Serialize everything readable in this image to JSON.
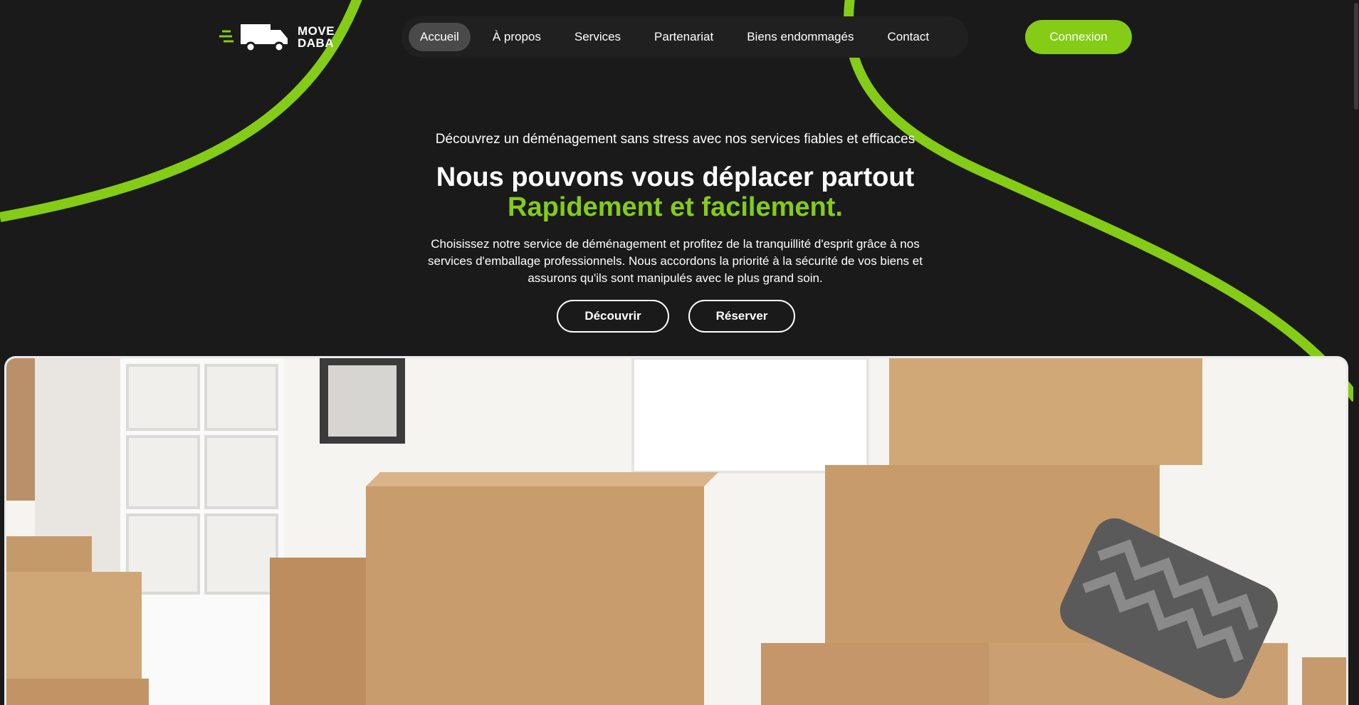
{
  "brand": {
    "line1": "MOVE",
    "line2": "DABA",
    "accent_color": "#84cc16"
  },
  "nav": {
    "items": [
      {
        "label": "Accueil",
        "active": true
      },
      {
        "label": "À propos"
      },
      {
        "label": "Services"
      },
      {
        "label": "Partenariat"
      },
      {
        "label": "Biens endommagés"
      },
      {
        "label": "Contact"
      }
    ],
    "login_label": "Connexion"
  },
  "hero": {
    "tagline": "Découvrez un déménagement sans stress avec nos services fiables et efficaces",
    "title": "Nous pouvons vous déplacer partout",
    "title_highlight": "Rapidement et facilement.",
    "description": "Choisissez notre service de déménagement et profitez de la tranquillité d'esprit grâce à nos services d'emballage professionnels. Nous accordons la priorité à la sécurité de vos biens et assurons qu'ils sont manipulés avec le plus grand soin.",
    "discover_label": "Découvrir",
    "book_label": "Réserver"
  },
  "image": {
    "subject": "moving-boxes-photo"
  }
}
